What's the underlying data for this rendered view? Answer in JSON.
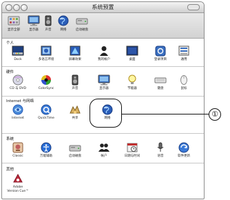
{
  "window": {
    "title": "系统预置"
  },
  "toolbar": {
    "items": [
      {
        "label": "显示全部",
        "icon": "show-all-icon"
      },
      {
        "label": "显示器",
        "icon": "display-icon"
      },
      {
        "label": "声音",
        "icon": "sound-icon"
      },
      {
        "label": "网络",
        "icon": "network-icon"
      },
      {
        "label": "启动磁盘",
        "icon": "startup-disk-icon"
      }
    ]
  },
  "sections": [
    {
      "title": "个人",
      "items": [
        {
          "label": "Dock",
          "icon": "dock-icon"
        },
        {
          "label": "多语言环境",
          "icon": "international-icon"
        },
        {
          "label": "屏幕效果",
          "icon": "screen-effects-icon"
        },
        {
          "label": "我的帐户",
          "icon": "my-account-icon"
        },
        {
          "label": "桌面",
          "icon": "desktop-icon"
        },
        {
          "label": "登录项目",
          "icon": "login-items-icon"
        },
        {
          "label": "通用",
          "icon": "general-icon"
        }
      ]
    },
    {
      "title": "硬件",
      "items": [
        {
          "label": "CD 与 DVD",
          "icon": "cd-dvd-icon"
        },
        {
          "label": "ColorSync",
          "icon": "colorsync-icon"
        },
        {
          "label": "声音",
          "icon": "sound-icon"
        },
        {
          "label": "显示器",
          "icon": "display-icon"
        },
        {
          "label": "节能器",
          "icon": "energy-saver-icon"
        },
        {
          "label": "键盘",
          "icon": "keyboard-icon"
        },
        {
          "label": "鼠标",
          "icon": "mouse-icon"
        }
      ]
    },
    {
      "title": "Internet 与网络",
      "items": [
        {
          "label": "Internet",
          "icon": "internet-icon"
        },
        {
          "label": "QuickTime",
          "icon": "quicktime-icon"
        },
        {
          "label": "共享",
          "icon": "sharing-icon"
        },
        {
          "label": "网络",
          "icon": "network-icon"
        }
      ]
    },
    {
      "title": "系统",
      "items": [
        {
          "label": "Classic",
          "icon": "classic-icon"
        },
        {
          "label": "万能辅助",
          "icon": "universal-access-icon"
        },
        {
          "label": "启动磁盘",
          "icon": "startup-disk-icon"
        },
        {
          "label": "帐户",
          "icon": "accounts-icon"
        },
        {
          "label": "日期与时间",
          "icon": "date-time-icon"
        },
        {
          "label": "语音",
          "icon": "speech-icon"
        },
        {
          "label": "软件更新",
          "icon": "software-update-icon"
        }
      ]
    },
    {
      "title": "其他",
      "items": [
        {
          "label": "Adobe\nVersion Cue™",
          "icon": "adobe-version-cue-icon"
        }
      ]
    }
  ],
  "callout": {
    "number": "①"
  },
  "colors": {
    "selection": "#111111",
    "accent": "#2e6fd8"
  }
}
